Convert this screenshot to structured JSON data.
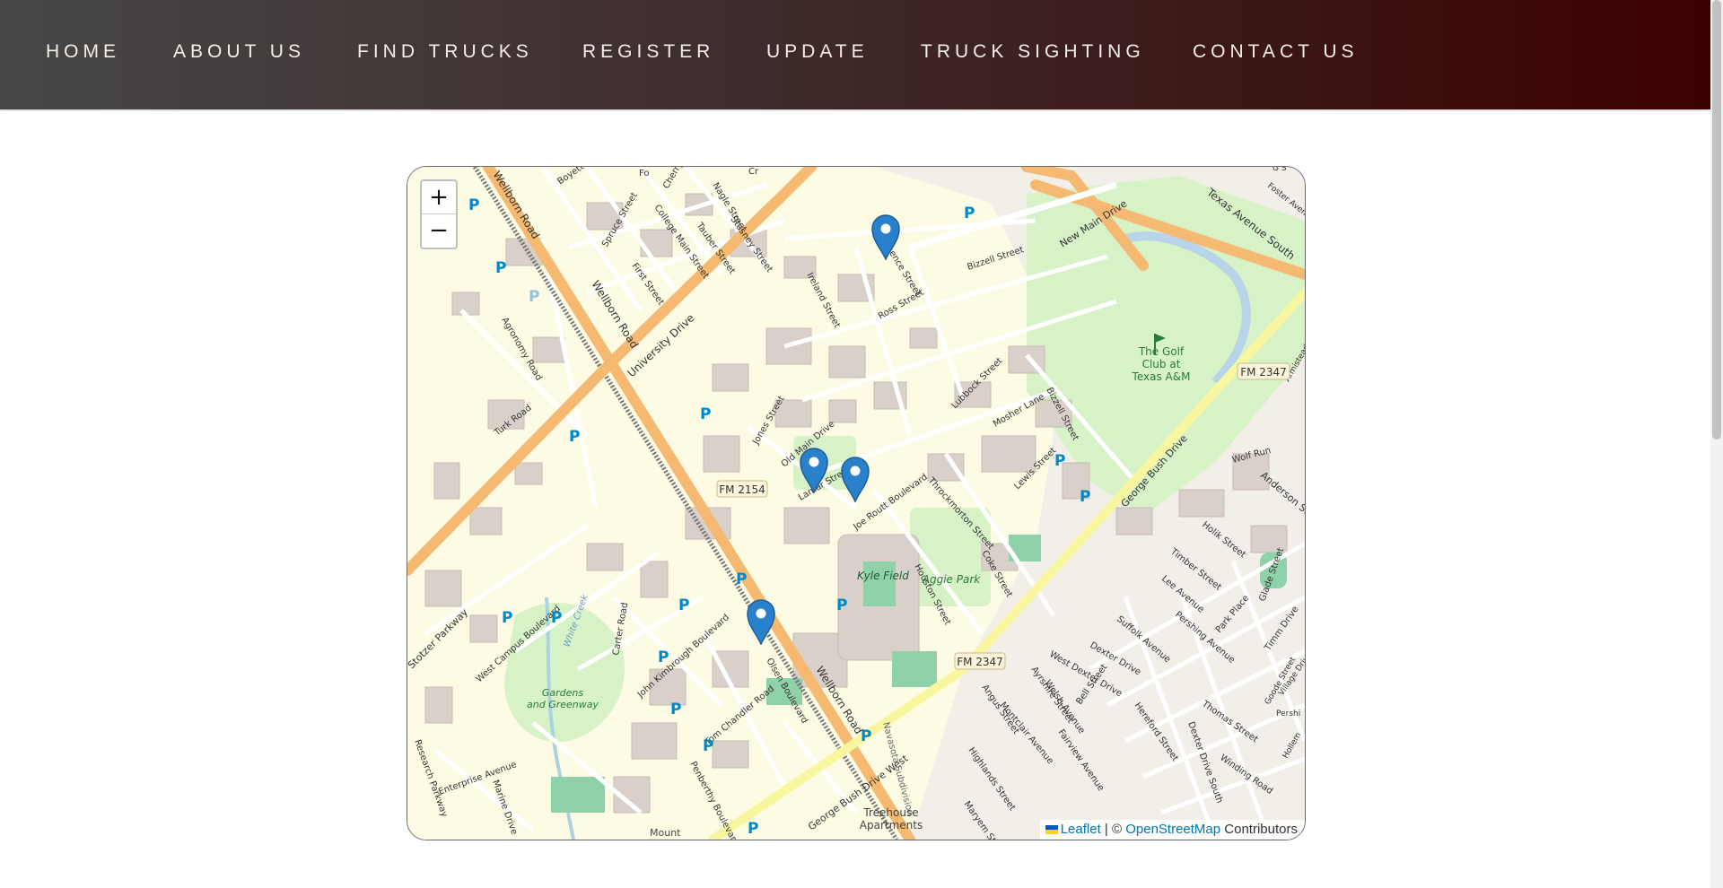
{
  "nav": {
    "items": [
      "HOME",
      "ABOUT US",
      "FIND TRUCKS",
      "REGISTER",
      "UPDATE",
      "TRUCK SIGHTING",
      "CONTACT US"
    ]
  },
  "map": {
    "zoom_in": "+",
    "zoom_out": "−",
    "attribution": {
      "leaflet": "Leaflet",
      "separator": " | © ",
      "osm": "OpenStreetMap",
      "suffix": " Contributors"
    },
    "labels": {
      "golf": [
        "The Golf",
        "Club at",
        "Texas A&M"
      ],
      "kyle_field": "Kyle Field",
      "aggie_park": "Aggie Park",
      "gardens": [
        "Gardens",
        "and Greenway"
      ],
      "treehouse": [
        "Treehouse",
        "Apartments"
      ],
      "white_creek": "White Creek",
      "mount": "Mount"
    },
    "road_labels": {
      "wellborn_top": "Wellborn Road",
      "wellborn_mid": "Wellborn Road",
      "wellborn_low": "Wellborn Road",
      "university": "University Drive",
      "new_main": "New Main Drive",
      "texas_ave": "Texas Avenue South",
      "george_bush": "George Bush Drive",
      "george_bush_west": "George Bush Drive West",
      "stotzer": "Stotzer Parkway",
      "bizzell_top": "Bizzell Street",
      "bizzell_mid": "Bizzell Street",
      "agronomy": "Agronomy Road",
      "turk": "Turk Road",
      "joe_routt": "Joe Routt Boulevard",
      "lamar": "Lamar Street",
      "olsen": "Olsen Boulevard",
      "dexter": "Dexter Drive",
      "west_dexter": "West Dexter Drive",
      "dexter_south": "Dexter Drive South",
      "throckmorton": "Throckmorton Street",
      "houston": "Houston Street",
      "ireland": "Ireland Street",
      "ross": "Ross Street",
      "spence": "Spence Street",
      "lubbock": "Lubbock Street",
      "mosher": "Mosher Lane",
      "lewis": "Lewis Street",
      "coke": "Coke Street",
      "john_kimbrough": "John Kimbrough Boulevard",
      "tom_chandler": "Tom Chandler Road",
      "penberthy": "Penberthy Boulevard",
      "west_campus": "West Campus Boulevard",
      "carter": "Carter Road",
      "enterprise": "Enterprise Avenue",
      "research": "Research Parkway",
      "marine": "Marine Drive",
      "navasota": "Navasota Subdivision",
      "timber": "Timber Street",
      "holik": "Holik Street",
      "anderson": "Anderson Street",
      "wolf_run": "Wolf Run",
      "lee": "Lee Avenue",
      "pershing": "Pershing Avenue",
      "suffolk": "Suffolk Avenue",
      "park_place": "Park Place",
      "glade": "Glade Street",
      "timm": "Timm Drive",
      "welsh": "Welsh Avenue",
      "fairview": "Fairview Avenue",
      "montclair": "Montclair Avenue",
      "angus": "Angus Street",
      "highlands": "Highlands Street",
      "ayrshire": "Ayrshire Street",
      "hereford": "Hereford Street",
      "thomas": "Thomas Street",
      "winding": "Winding Road",
      "bell": "Bell Street",
      "jones": "Jones Street",
      "old_main": "Old Main Drive",
      "boyett": "Boyett Street",
      "spruce": "Spruce Street",
      "nagle": "Nagle Street",
      "cherry": "Cherry Street",
      "college_main": "College Main Street",
      "tauber": "Tauber Street",
      "stasney": "Stasney Street",
      "first": "First Street",
      "fo": "Fo",
      "cr": "Cr",
      "foster": "Foster Avenue",
      "armistead": "Armistead",
      "village": "Village Drive",
      "goode": "Goode Street",
      "hollem": "Hollem",
      "pershi": "Pershi",
      "maryem": "Maryem Street",
      "gs": "G S"
    },
    "shields": [
      "FM 2154",
      "FM 2347",
      "FM 2347"
    ],
    "parking_symbol": "P",
    "marker_count": 4
  },
  "colors": {
    "nav_text": "#f4efe6",
    "marker": "#2a81cb",
    "major_road": "#f5b971",
    "minor_road": "#ffffff",
    "park": "#d8f2c8",
    "campus": "#fefbe5",
    "building": "#d9d0c9",
    "parking_label": "#0088cc"
  }
}
